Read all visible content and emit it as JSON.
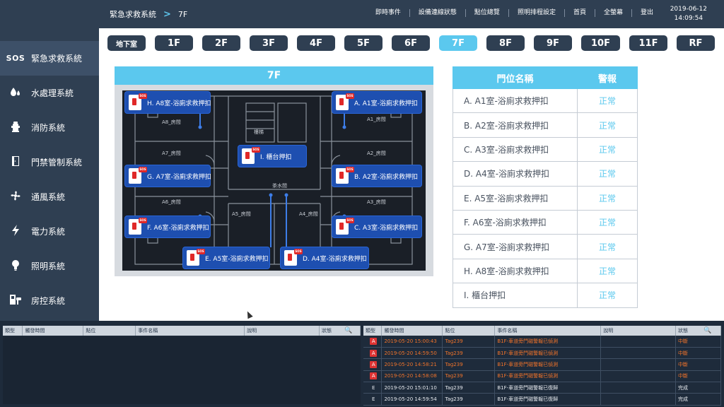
{
  "header": {
    "breadcrumb_root": "緊急求救系統",
    "breadcrumb_sep": ">",
    "breadcrumb_current": "7F",
    "nav": [
      "即時事件",
      "設備連線狀態",
      "點位總覽",
      "照明排程設定",
      "首頁",
      "全螢幕",
      "登出"
    ],
    "date": "2019-06-12",
    "time": "14:09:54"
  },
  "sidebar": {
    "items": [
      {
        "icon": "sos-icon",
        "glyph": "SOS",
        "label": "緊急求救系統"
      },
      {
        "icon": "water-drops-icon",
        "glyph": "💧",
        "label": "水處理系統"
      },
      {
        "icon": "fire-hydrant-icon",
        "glyph": "🧯",
        "label": "消防系統"
      },
      {
        "icon": "door-icon",
        "glyph": "🚪",
        "label": "門禁管制系統"
      },
      {
        "icon": "fan-icon",
        "glyph": "✤",
        "label": "通風系統"
      },
      {
        "icon": "lightning-icon",
        "glyph": "⚡",
        "label": "電力系統"
      },
      {
        "icon": "light-bulb-icon",
        "glyph": "💡",
        "label": "照明系統"
      },
      {
        "icon": "room-control-icon",
        "glyph": "🏨",
        "label": "房控系統"
      }
    ]
  },
  "floors": [
    "地下室",
    "1F",
    "2F",
    "3F",
    "4F",
    "5F",
    "6F",
    "7F",
    "8F",
    "9F",
    "10F",
    "11F",
    "RF"
  ],
  "active_floor": "7F",
  "plan": {
    "title": "7F",
    "rooms": [
      "A8_房間",
      "A1_房間",
      "A7_房間",
      "A2_房間",
      "A6_房間",
      "A3_房間",
      "A5_房間",
      "A4_房間",
      "樓梯",
      "茶水間"
    ],
    "markers": [
      "H. A8室-浴廁求救押扣",
      "A. A1室-浴廁求救押扣",
      "I. 櫃台押扣",
      "G. A7室-浴廁求救押扣",
      "B. A2室-浴廁求救押扣",
      "F. A6室-浴廁求救押扣",
      "C. A3室-浴廁求救押扣",
      "E. A5室-浴廁求救押扣",
      "D. A4室-浴廁求救押扣"
    ],
    "sos_tag": "SOS"
  },
  "alarm_table": {
    "col_name": "門位名稱",
    "col_alarm": "警報",
    "rows": [
      {
        "name": "A. A1室-浴廁求救押扣",
        "status": "正常"
      },
      {
        "name": "B. A2室-浴廁求救押扣",
        "status": "正常"
      },
      {
        "name": "C. A3室-浴廁求救押扣",
        "status": "正常"
      },
      {
        "name": "D. A4室-浴廁求救押扣",
        "status": "正常"
      },
      {
        "name": "E. A5室-浴廁求救押扣",
        "status": "正常"
      },
      {
        "name": "F. A6室-浴廁求救押扣",
        "status": "正常"
      },
      {
        "name": "G. A7室-浴廁求救押扣",
        "status": "正常"
      },
      {
        "name": "H. A8室-浴廁求救押扣",
        "status": "正常"
      },
      {
        "name": "I. 櫃台押扣",
        "status": "正常"
      }
    ]
  },
  "event_tables": {
    "headers": [
      "類型",
      "觸發時間",
      "點位",
      "事件名稱",
      "說明",
      "狀態"
    ],
    "right_rows": [
      {
        "type": "A",
        "time": "2019-05-20 15:00:43",
        "point": "Tag239",
        "event": "B1F-車道旁門磁警報已偵測",
        "note": "",
        "status": "中斷",
        "alert": true
      },
      {
        "type": "A",
        "time": "2019-05-20 14:59:50",
        "point": "Tag239",
        "event": "B1F-車道旁門磁警報已偵測",
        "note": "",
        "status": "中斷",
        "alert": true
      },
      {
        "type": "A",
        "time": "2019-05-20 14:58:21",
        "point": "Tag239",
        "event": "B1F-車道旁門磁警報已偵測",
        "note": "",
        "status": "中斷",
        "alert": true
      },
      {
        "type": "A",
        "time": "2019-05-20 14:58:08",
        "point": "Tag239",
        "event": "B1F-車道旁門磁警報已偵測",
        "note": "",
        "status": "中斷",
        "alert": true
      },
      {
        "type": "E",
        "time": "2019-05-20 15:01:10",
        "point": "Tag239",
        "event": "B1F-車道旁門磁警報已復歸",
        "note": "",
        "status": "完成",
        "alert": false
      },
      {
        "type": "E",
        "time": "2019-05-20 14:59:54",
        "point": "Tag239",
        "event": "B1F-車道旁門磁警報已復歸",
        "note": "",
        "status": "完成",
        "alert": false
      }
    ]
  },
  "colors": {
    "accent": "#5bc8ee",
    "navy": "#2f3f52",
    "alert": "#f0732a",
    "marker": "#1e4fb0"
  }
}
